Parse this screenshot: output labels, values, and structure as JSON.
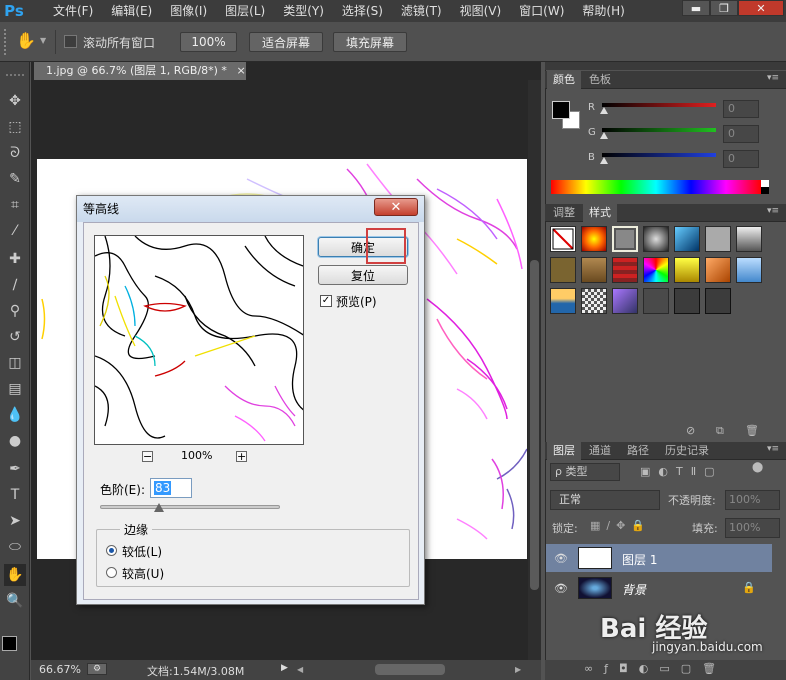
{
  "app": {
    "logo": "Ps"
  },
  "menu": [
    "文件(F)",
    "编辑(E)",
    "图像(I)",
    "图层(L)",
    "类型(Y)",
    "选择(S)",
    "滤镜(T)",
    "视图(V)",
    "窗口(W)",
    "帮助(H)"
  ],
  "window_controls": {
    "minimize": "▬",
    "restore": "❐",
    "close": "✕"
  },
  "options": {
    "scroll_all_label": "滚动所有窗口",
    "zoom_value": "100%",
    "fit_screen": "适合屏幕",
    "fill_screen": "填充屏幕"
  },
  "document": {
    "tab_title": "1.jpg @ 66.7% (图层 1, RGB/8*) *",
    "tab_close": "×",
    "zoom": "66.67%",
    "doc_size": "文档:1.54M/3.08M"
  },
  "dialog": {
    "title": "等高线",
    "close": "✕",
    "ok": "确定",
    "reset": "复位",
    "preview_label": "预览(P)",
    "preview_checked": true,
    "zoom_out": "−",
    "zoom_level": "100%",
    "zoom_in": "+",
    "level_label": "色阶(E):",
    "level_value": "83",
    "level_fraction": 0.33,
    "edge_group": "边缘",
    "edge_lower": "较低(L)",
    "edge_upper": "较高(U)",
    "edge_selected": "lower"
  },
  "color_panel": {
    "tabs": [
      "颜色",
      "色板"
    ],
    "channels": [
      {
        "label": "R",
        "value": "0",
        "color": "#e02020"
      },
      {
        "label": "G",
        "value": "0",
        "color": "#20c020"
      },
      {
        "label": "B",
        "value": "0",
        "color": "#2040e0"
      }
    ]
  },
  "styles_panel": {
    "tabs": [
      "调整",
      "样式"
    ]
  },
  "layers_panel": {
    "tabs": [
      "图层",
      "通道",
      "路径",
      "历史记录"
    ],
    "filter_label": "ρ 类型",
    "blend_mode": "正常",
    "opacity_label": "不透明度:",
    "opacity_value": "100%",
    "lock_label": "锁定:",
    "fill_label": "填充:",
    "fill_value": "100%",
    "layers": [
      {
        "name": "图层 1",
        "selected": true
      },
      {
        "name": "背景",
        "selected": false,
        "locked": true
      }
    ],
    "lock_icon": "🔒"
  },
  "watermark": {
    "brand": "Bai 经验",
    "url": "jingyan.baidu.com"
  },
  "colors": {
    "accent": "#2fa3f0",
    "highlight": "#d04040"
  }
}
